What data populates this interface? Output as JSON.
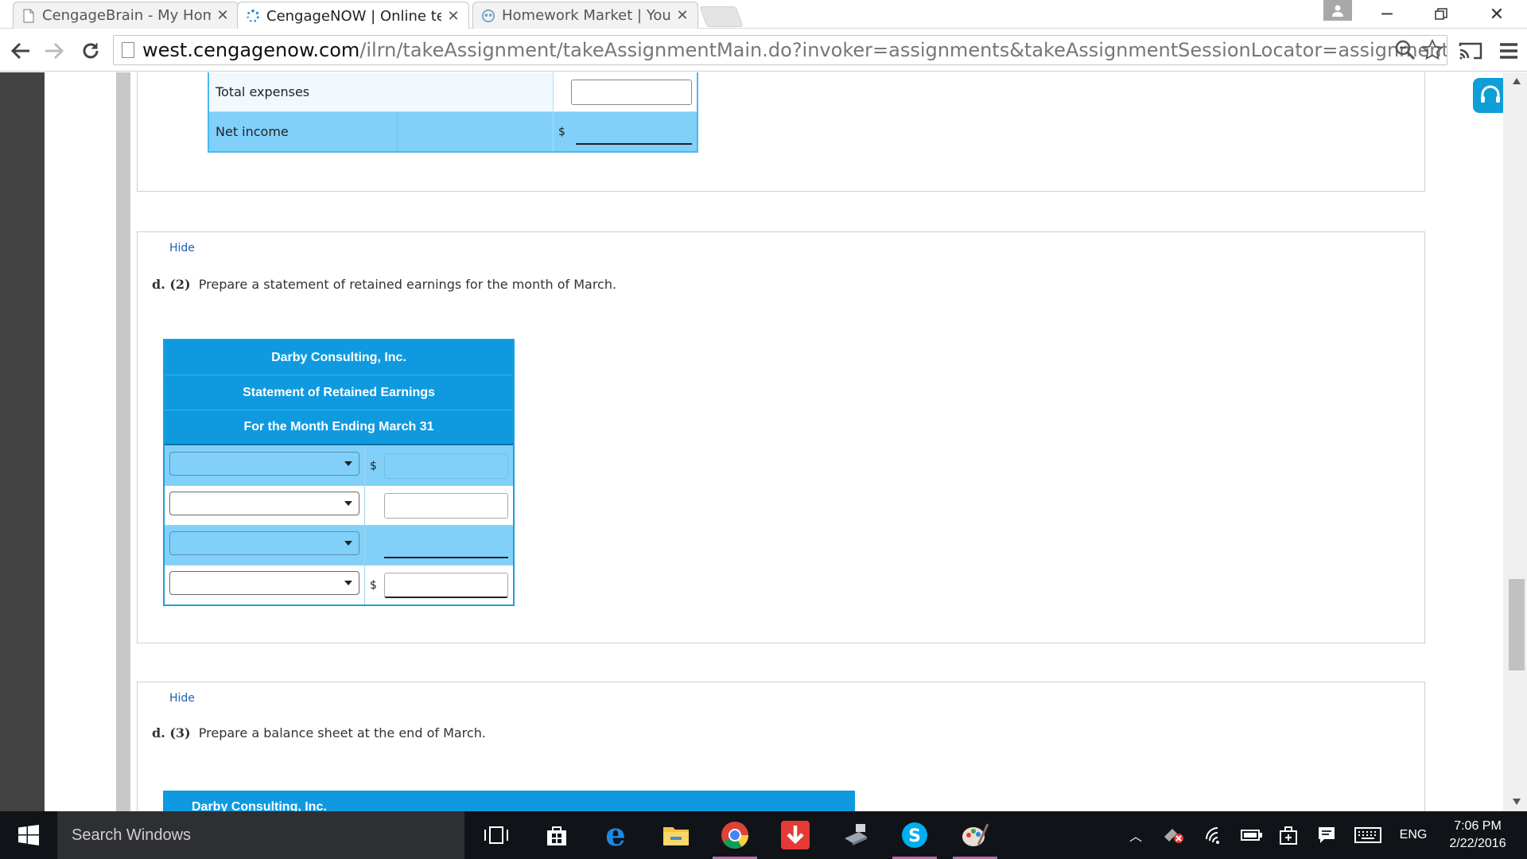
{
  "browser": {
    "tabs": [
      {
        "title": "CengageBrain - My Home",
        "favicon": "page-icon"
      },
      {
        "title": "CengageNOW | Online tea",
        "favicon": "cengage-spinner-icon"
      },
      {
        "title": "Homework Market | Your H",
        "favicon": "homework-market-icon"
      }
    ],
    "url_host": "west.cengagenow.com",
    "url_path": "/ilrn/takeAssignment/takeAssignmentMain.do?invoker=assignments&takeAssignmentSessionLocator=assignment-take"
  },
  "income_statement": {
    "total_expenses_label": "Total expenses",
    "net_income_label": "Net income",
    "currency": "$"
  },
  "section_d2": {
    "hide_label": "Hide",
    "question_prefix": "d. (2)",
    "question_text": "Prepare a statement of retained earnings for the month of March.",
    "company": "Darby Consulting, Inc.",
    "statement_title": "Statement of Retained Earnings",
    "period": "For the Month Ending March 31",
    "currency": "$"
  },
  "section_d3": {
    "hide_label": "Hide",
    "question_prefix": "d. (3)",
    "question_text": "Prepare a balance sheet at the end of March.",
    "company": "Darby Consulting, Inc."
  },
  "taskbar": {
    "search_placeholder": "Search Windows",
    "language": "ENG",
    "time": "7:06 PM",
    "date": "2/22/2016"
  },
  "colors": {
    "header_blue": "#0f9ae0",
    "row_blue": "#80d0fa",
    "link_blue": "#1a5fb4"
  }
}
